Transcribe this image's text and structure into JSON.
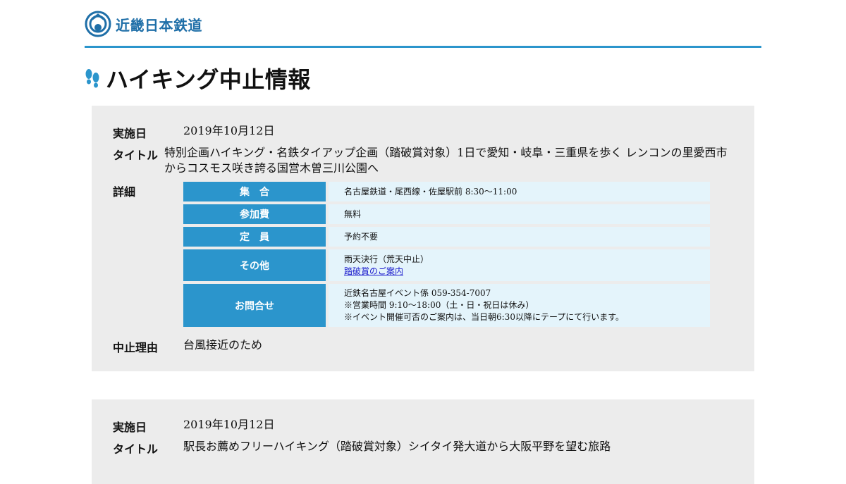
{
  "header": {
    "logo_text": "近畿日本鉄道"
  },
  "page": {
    "title": "ハイキング中止情報"
  },
  "colors": {
    "accent": "#2b95cc",
    "card_bg": "#ececec",
    "cell_bg": "#e4f4fb",
    "link": "#1a1acc"
  },
  "events": [
    {
      "date_label": "実施日",
      "date": "2019年10月12日",
      "title_label": "タイトル",
      "title_line1": "特別企画ハイキング・名鉄タイアップ企画（踏破賞対象）1日で愛知・岐阜・三重県を歩く レンコンの里愛西市",
      "title_line2": "からコスモス咲き誇る国営木曽三川公園へ",
      "detail_label": "詳細",
      "details": {
        "meeting_label": "集　合",
        "meeting_value": "名古屋鉄道・尾西線・佐屋駅前 8:30～11:00",
        "fee_label": "参加費",
        "fee_value": "無料",
        "capacity_label": "定　員",
        "capacity_value": "予約不要",
        "other_label": "その他",
        "other_value": "雨天決行（荒天中止）",
        "other_link": "踏破賞のご案内",
        "contact_label": "お問合せ",
        "contact_line1": "近鉄名古屋イベント係 059-354-7007",
        "contact_line2": "※営業時間 9:10～18:00（土・日・祝日は休み）",
        "contact_line3": "※イベント開催可否のご案内は、当日朝6:30以降にテープにて行います。"
      },
      "reason_label": "中止理由",
      "reason": "台風接近のため"
    },
    {
      "date_label": "実施日",
      "date": "2019年10月12日",
      "title_label": "タイトル",
      "title_line1": "駅長お薦めフリーハイキング（踏破賞対象）シイタイ発大道から大阪平野を望む旅路"
    }
  ]
}
